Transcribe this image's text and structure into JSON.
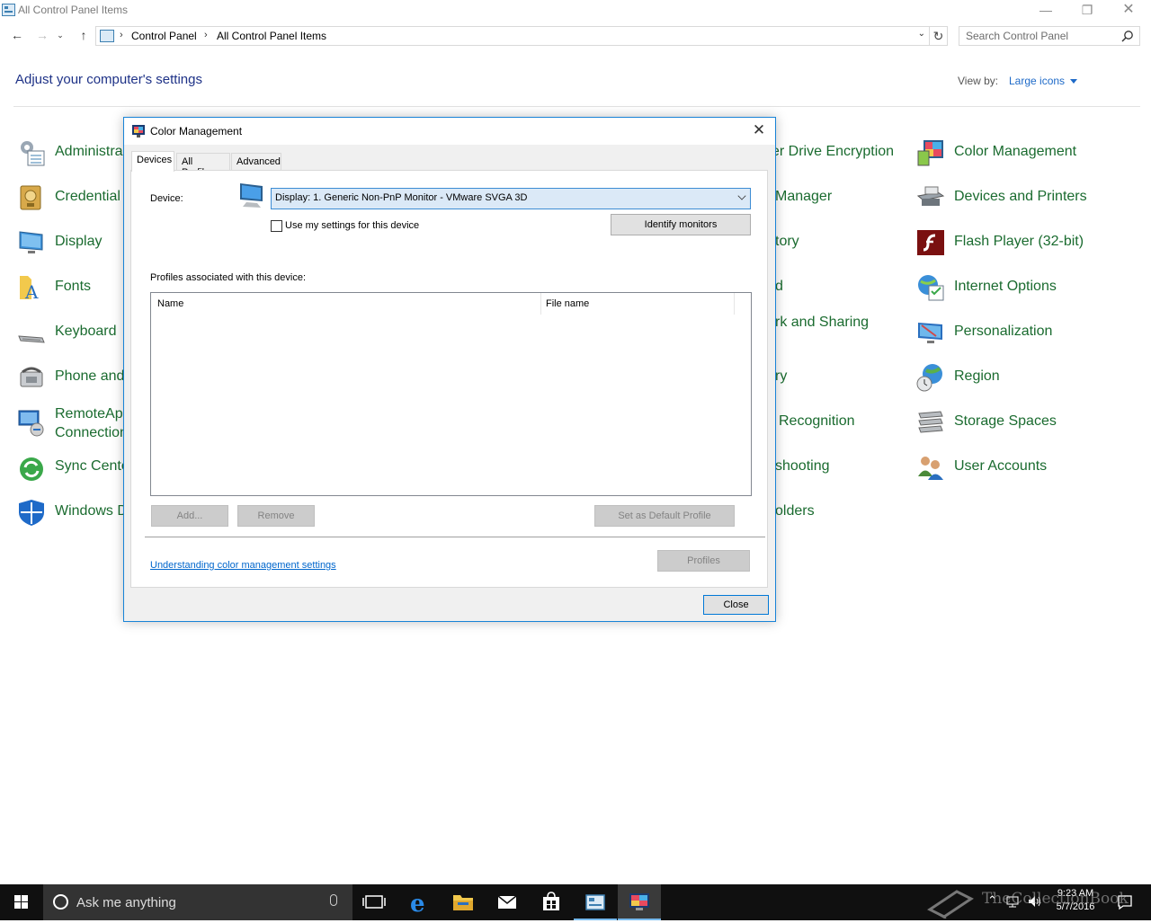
{
  "window": {
    "title": "All Control Panel Items",
    "breadcrumb": [
      "Control Panel",
      "All Control Panel Items"
    ],
    "search_placeholder": "Search Control Panel"
  },
  "header": {
    "heading": "Adjust your computer's settings",
    "view_by_label": "View by:",
    "view_by_value": "Large icons"
  },
  "items_left": [
    {
      "label": "Administra",
      "icon": "admin-tools-icon"
    },
    {
      "label": "Credential",
      "icon": "credential-manager-icon"
    },
    {
      "label": "Display",
      "icon": "display-icon"
    },
    {
      "label": "Fonts",
      "icon": "fonts-icon"
    },
    {
      "label": "Keyboard",
      "icon": "keyboard-icon"
    },
    {
      "label": "Phone and",
      "icon": "phone-modem-icon"
    },
    {
      "label_line1": "RemoteApp",
      "label_line2": "Connection",
      "icon": "remoteapp-icon"
    },
    {
      "label": "Sync Cente",
      "icon": "sync-center-icon"
    },
    {
      "label": "Windows D",
      "icon": "windows-defender-icon"
    }
  ],
  "items_middle": [
    {
      "label": "er Drive Encryption"
    },
    {
      "label": "Manager"
    },
    {
      "label": "tory"
    },
    {
      "label": "d"
    },
    {
      "label": "rk and Sharing"
    },
    {
      "label": "ry"
    },
    {
      "label": "Recognition"
    },
    {
      "label": "shooting"
    },
    {
      "label": "olders"
    }
  ],
  "items_right": [
    {
      "label": "Color Management",
      "icon": "color-management-icon"
    },
    {
      "label": "Devices and Printers",
      "icon": "devices-printers-icon"
    },
    {
      "label": "Flash Player (32-bit)",
      "icon": "flash-player-icon"
    },
    {
      "label": "Internet Options",
      "icon": "internet-options-icon"
    },
    {
      "label": "Personalization",
      "icon": "personalization-icon"
    },
    {
      "label": "Region",
      "icon": "region-icon"
    },
    {
      "label": "Storage Spaces",
      "icon": "storage-spaces-icon"
    },
    {
      "label": "User Accounts",
      "icon": "user-accounts-icon"
    }
  ],
  "dialog": {
    "title": "Color Management",
    "tabs": [
      "Devices",
      "All Profiles",
      "Advanced"
    ],
    "device_label": "Device:",
    "device_value": "Display: 1. Generic Non-PnP Monitor - VMware SVGA 3D",
    "use_settings_label": "Use my settings for this device",
    "identify_button": "Identify monitors",
    "profiles_label": "Profiles associated with this device:",
    "columns": [
      "Name",
      "File name"
    ],
    "add_button": "Add...",
    "remove_button": "Remove",
    "set_default_button": "Set as Default Profile",
    "link_text": "Understanding color management settings",
    "profiles_button": "Profiles",
    "close_button": "Close"
  },
  "taskbar": {
    "search_text": "Ask me anything",
    "time": "9:23 AM",
    "date": "5/7/2016"
  },
  "watermark": "TheCollectionBook"
}
